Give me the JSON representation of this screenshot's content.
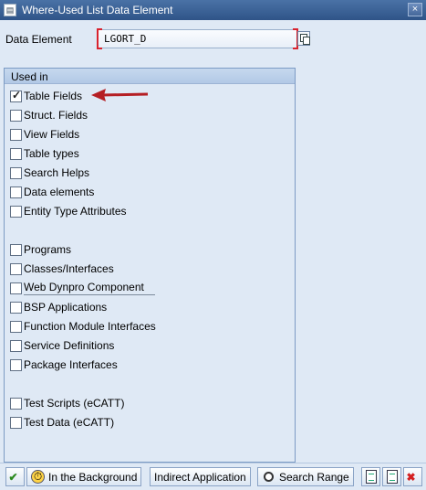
{
  "window": {
    "title": "Where-Used List Data Element",
    "close_glyph": "×",
    "icon": "window-icon"
  },
  "data_element": {
    "label": "Data Element",
    "value": "LGORT_D"
  },
  "used_in": {
    "header": "Used in",
    "items": [
      {
        "label": "Table Fields",
        "checked": true
      },
      {
        "label": "Struct. Fields",
        "checked": false
      },
      {
        "label": "View Fields",
        "checked": false
      },
      {
        "label": "Table types",
        "checked": false
      },
      {
        "label": "Search Helps",
        "checked": false
      },
      {
        "label": "Data elements",
        "checked": false
      },
      {
        "label": "Entity Type Attributes",
        "checked": false
      },
      {
        "label": "Programs",
        "checked": false
      },
      {
        "label": "Classes/Interfaces",
        "checked": false
      },
      {
        "label": "Web Dynpro Component",
        "checked": false
      },
      {
        "label": "BSP Applications",
        "checked": false
      },
      {
        "label": "Function Module Interfaces",
        "checked": false
      },
      {
        "label": "Service Definitions",
        "checked": false
      },
      {
        "label": "Package Interfaces",
        "checked": false
      },
      {
        "label": "Test Scripts (eCATT)",
        "checked": false
      },
      {
        "label": "Test Data (eCATT)",
        "checked": false
      }
    ]
  },
  "toolbar": {
    "background_label": "In the Background",
    "indirect_label": "Indirect Application",
    "search_range_label": "Search Range"
  },
  "colors": {
    "accent_red": "#d9232e",
    "title_bar": "#3a5f93"
  }
}
